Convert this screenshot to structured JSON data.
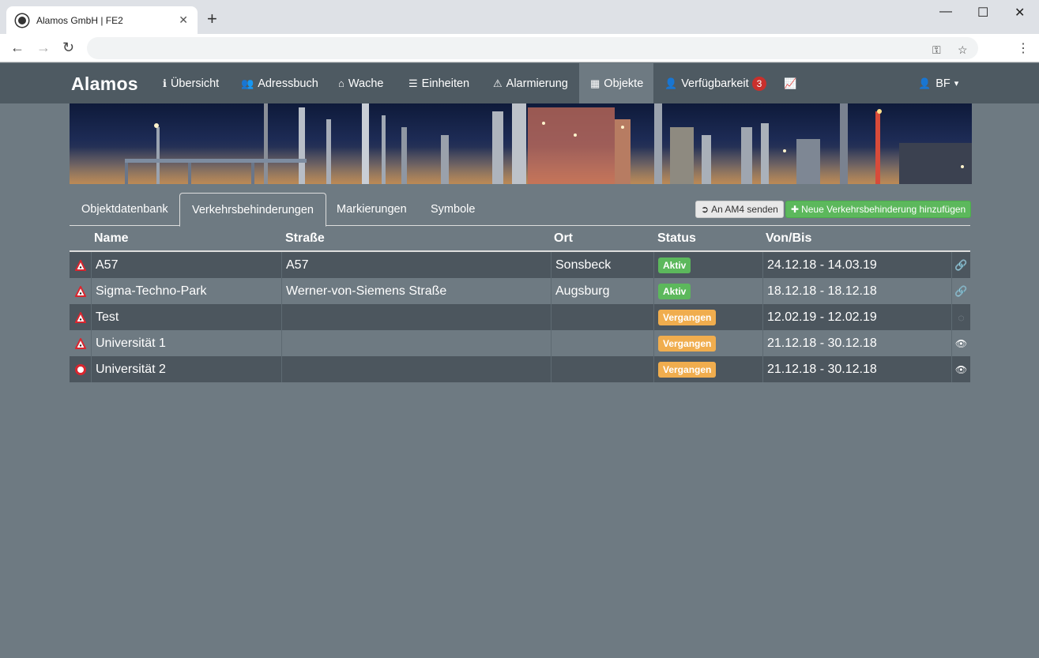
{
  "browser": {
    "tab_title": "Alamos GmbH | FE2",
    "tab_close": "✕",
    "new_tab": "+",
    "win_min": "—",
    "win_max": "☐",
    "win_close": "✕",
    "back": "←",
    "forward": "→",
    "reload": "↻",
    "key_icon": "⚿",
    "star_icon": "☆",
    "menu_icon": "⋮"
  },
  "navbar": {
    "logo": "Alamos",
    "items": [
      {
        "icon": "info-icon",
        "glyph": "ℹ",
        "label": "Übersicht"
      },
      {
        "icon": "users-icon",
        "glyph": "👥",
        "label": "Adressbuch"
      },
      {
        "icon": "home-icon",
        "glyph": "⌂",
        "label": "Wache"
      },
      {
        "icon": "list-icon",
        "glyph": "☰",
        "label": "Einheiten"
      },
      {
        "icon": "warning-icon",
        "glyph": "⚠",
        "label": "Alarmierung"
      },
      {
        "icon": "building-icon",
        "glyph": "▦",
        "label": "Objekte",
        "active": true
      },
      {
        "icon": "user-icon",
        "glyph": "👤",
        "label": "Verfügbarkeit",
        "badge": "3"
      },
      {
        "icon": "chart-line-icon",
        "glyph": "📈",
        "label": ""
      }
    ],
    "user": {
      "glyph": "👤",
      "label": "BF",
      "caret": "▾"
    }
  },
  "tabs": [
    {
      "label": "Objektdatenbank"
    },
    {
      "label": "Verkehrsbehinderungen",
      "active": true
    },
    {
      "label": "Markierungen"
    },
    {
      "label": "Symbole"
    }
  ],
  "actions": {
    "send_am4": "An AM4 senden",
    "send_am4_icon": "➲",
    "add_new": "Neue Verkehrsbehinderung hinzufügen",
    "add_new_icon": "✚"
  },
  "table": {
    "headers": [
      "Name",
      "Straße",
      "Ort",
      "Status",
      "Von/Bis"
    ],
    "rows": [
      {
        "icon": "warning",
        "name": "A57",
        "strasse": "A57",
        "ort": "Sonsbeck",
        "status": "Aktiv",
        "status_type": "success",
        "von_bis": "24.12.18 - 14.03.19",
        "action": "link-icon",
        "action_glyph": "🔗"
      },
      {
        "icon": "warning",
        "name": "Sigma-Techno-Park",
        "strasse": "Werner-von-Siemens Straße",
        "ort": "Augsburg",
        "status": "Aktiv",
        "status_type": "success",
        "von_bis": "18.12.18 - 18.12.18",
        "action": "link-icon",
        "action_glyph": "🔗"
      },
      {
        "icon": "warning",
        "name": "Test",
        "strasse": "",
        "ort": "",
        "status": "Vergangen",
        "status_type": "warning",
        "von_bis": "12.02.19 - 12.02.19",
        "action": "eye-slash-icon",
        "action_glyph": "◌"
      },
      {
        "icon": "warning",
        "name": "Universität 1",
        "strasse": "",
        "ort": "",
        "status": "Vergangen",
        "status_type": "warning",
        "von_bis": "21.12.18 - 30.12.18",
        "action": "eye-icon",
        "action_glyph": "👁"
      },
      {
        "icon": "no-entry",
        "name": "Universität 2",
        "strasse": "",
        "ort": "",
        "status": "Vergangen",
        "status_type": "warning",
        "von_bis": "21.12.18 - 30.12.18",
        "action": "eye-icon",
        "action_glyph": "👁"
      }
    ]
  },
  "colors": {
    "navbar": "#4e5a62",
    "page_bg": "#6e7a82",
    "row_dark": "#4c565e",
    "success": "#5cb85c",
    "warning": "#f0ad4e",
    "badge": "#c9302c"
  }
}
